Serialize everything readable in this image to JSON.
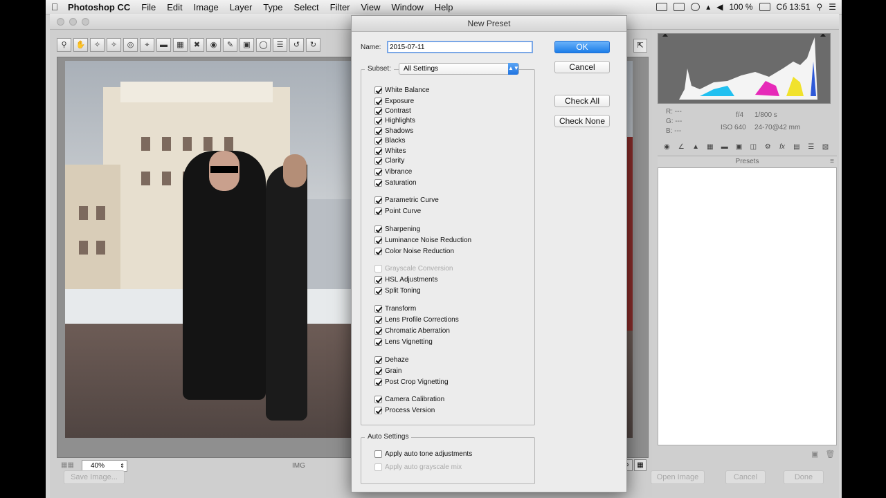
{
  "menubar": {
    "app": "Photoshop CC",
    "items": [
      "File",
      "Edit",
      "Image",
      "Layer",
      "Type",
      "Select",
      "Filter",
      "View",
      "Window",
      "Help"
    ],
    "battery": "100 %",
    "clock": "Сб 13:51"
  },
  "acr": {
    "zoom": "40%",
    "filename_fragment": "IMG",
    "save_image": "Save Image...",
    "open_image": "Open Image",
    "cancel": "Cancel",
    "done": "Done",
    "rgb": {
      "r": "R:",
      "g": "G:",
      "b": "B:",
      "dash": "---"
    },
    "camera": {
      "aperture": "f/4",
      "shutter": "1/800 s",
      "iso": "ISO 640",
      "lens": "24-70@42 mm"
    },
    "presets_header": "Presets"
  },
  "dialog": {
    "title": "New Preset",
    "name_label": "Name:",
    "name_value": "2015-07-11",
    "ok": "OK",
    "cancel": "Cancel",
    "check_all": "Check All",
    "check_none": "Check None",
    "subset_label": "Subset:",
    "subset_value": "All Settings",
    "settings": [
      {
        "label": "White Balance",
        "checked": true
      },
      {
        "label": "Exposure",
        "checked": true
      },
      {
        "label": "Contrast",
        "checked": true
      },
      {
        "label": "Highlights",
        "checked": true
      },
      {
        "label": "Shadows",
        "checked": true
      },
      {
        "label": "Blacks",
        "checked": true
      },
      {
        "label": "Whites",
        "checked": true
      },
      {
        "label": "Clarity",
        "checked": true
      },
      {
        "label": "Vibrance",
        "checked": true
      },
      {
        "label": "Saturation",
        "checked": true
      },
      {
        "label": "Parametric Curve",
        "checked": true
      },
      {
        "label": "Point Curve",
        "checked": true
      },
      {
        "label": "Sharpening",
        "checked": true
      },
      {
        "label": "Luminance Noise Reduction",
        "checked": true
      },
      {
        "label": "Color Noise Reduction",
        "checked": true
      },
      {
        "label": "Grayscale Conversion",
        "checked": false,
        "disabled": true
      },
      {
        "label": "HSL Adjustments",
        "checked": true
      },
      {
        "label": "Split Toning",
        "checked": true
      },
      {
        "label": "Transform",
        "checked": true
      },
      {
        "label": "Lens Profile Corrections",
        "checked": true
      },
      {
        "label": "Chromatic Aberration",
        "checked": true
      },
      {
        "label": "Lens Vignetting",
        "checked": true
      },
      {
        "label": "Dehaze",
        "checked": true
      },
      {
        "label": "Grain",
        "checked": true
      },
      {
        "label": "Post Crop Vignetting",
        "checked": true
      },
      {
        "label": "Camera Calibration",
        "checked": true
      },
      {
        "label": "Process Version",
        "checked": true
      }
    ],
    "auto_settings_title": "Auto Settings",
    "auto_tone": "Apply auto tone adjustments",
    "auto_grayscale": "Apply auto grayscale mix"
  },
  "colors": {
    "accent_blue": "#1c7de8",
    "dialog_bg": "#ececec"
  }
}
